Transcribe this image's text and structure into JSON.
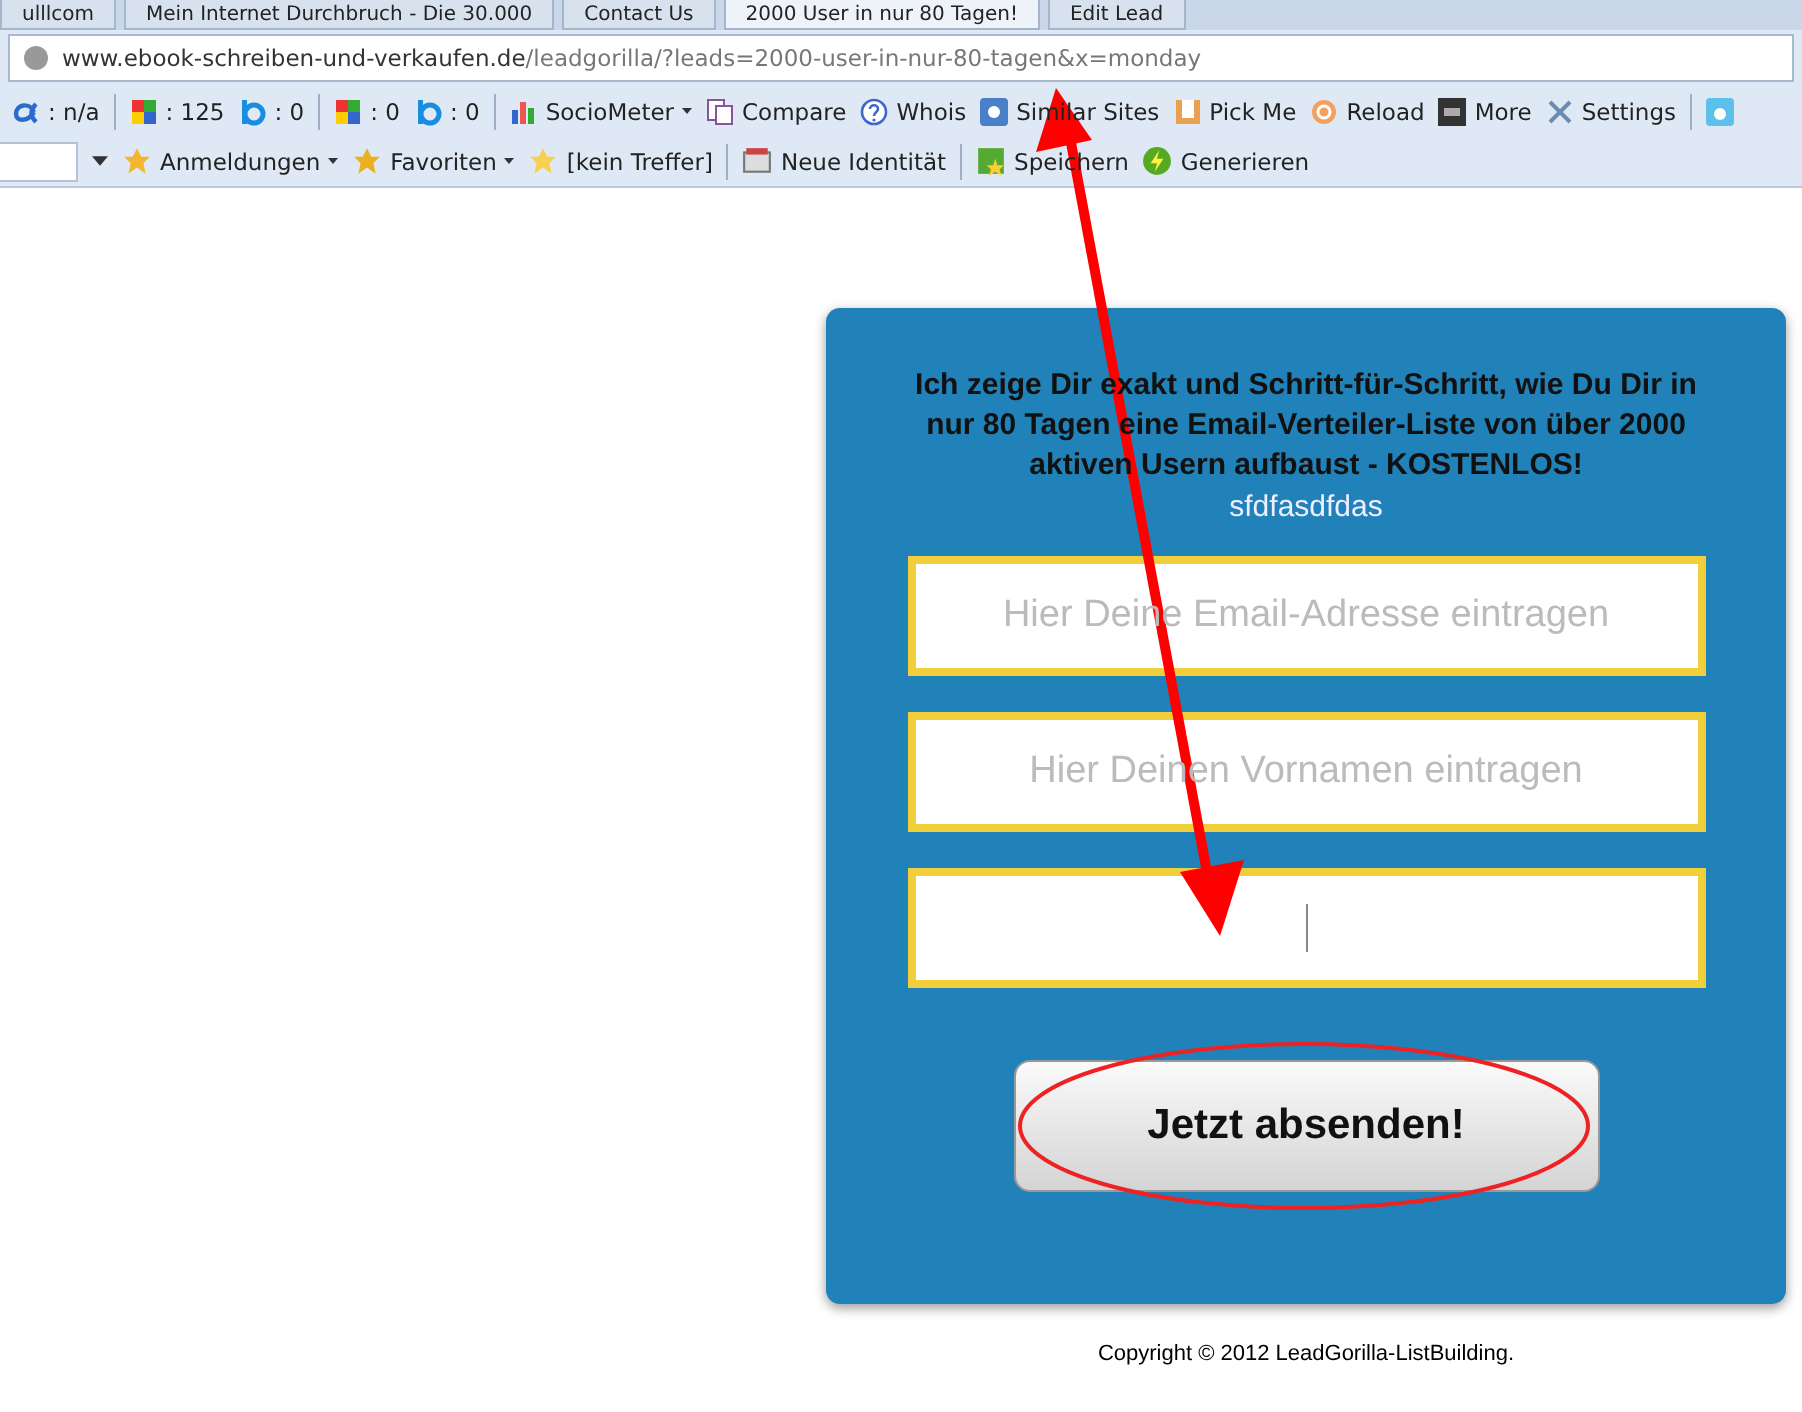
{
  "tabs": [
    {
      "title": "ulllcom",
      "selected": false
    },
    {
      "title": "Mein Internet Durchbruch - Die 30.000",
      "selected": false
    },
    {
      "title": "Contact Us",
      "selected": false
    },
    {
      "title": "2000 User in nur 80 Tagen!",
      "selected": true
    },
    {
      "title": "Edit Lead",
      "selected": false
    }
  ],
  "address_bar": {
    "domain": "www.ebook-schreiben-und-verkaufen.de",
    "path": "/leadgorilla/?leads=2000-user-in-nur-80-tagen&x=monday"
  },
  "toolbar_1": [
    {
      "kind": "stat",
      "label": ": n/a"
    },
    {
      "kind": "sep"
    },
    {
      "kind": "stat",
      "label": ": 125"
    },
    {
      "kind": "stat",
      "label": ": 0"
    },
    {
      "kind": "sep"
    },
    {
      "kind": "stat",
      "label": ": 0"
    },
    {
      "kind": "stat",
      "label": ": 0"
    },
    {
      "kind": "sep"
    },
    {
      "kind": "menu",
      "label": "SocioMeter"
    },
    {
      "kind": "button",
      "label": "Compare"
    },
    {
      "kind": "button",
      "label": "Whois"
    },
    {
      "kind": "button",
      "label": "Similar Sites"
    },
    {
      "kind": "button",
      "label": "Pick Me"
    },
    {
      "kind": "button",
      "label": "Reload"
    },
    {
      "kind": "button",
      "label": "More"
    },
    {
      "kind": "button",
      "label": "Settings"
    },
    {
      "kind": "sep"
    },
    {
      "kind": "icon"
    }
  ],
  "toolbar_2": [
    {
      "kind": "combo"
    },
    {
      "kind": "menu",
      "label": "Anmeldungen"
    },
    {
      "kind": "menu",
      "label": "Favoriten"
    },
    {
      "kind": "button",
      "label": "[kein Treffer]"
    },
    {
      "kind": "sep"
    },
    {
      "kind": "button",
      "label": "Neue Identität"
    },
    {
      "kind": "sep"
    },
    {
      "kind": "button",
      "label": "Speichern"
    },
    {
      "kind": "button",
      "label": "Generieren"
    }
  ],
  "signup_card": {
    "headline": "Ich zeige Dir exakt und Schritt-für-Schritt, wie Du Dir in nur 80 Tagen eine Email-Verteiler-Liste von über 2000 aktiven Usern aufbaust - KOSTENLOS!",
    "subline": "sfdfasdfdas",
    "fields": [
      {
        "placeholder": "Hier Deine Email-Adresse eintragen",
        "focused": false
      },
      {
        "placeholder": "Hier Deinen Vornamen eintragen",
        "focused": false
      },
      {
        "focused": true
      }
    ],
    "submit": "Jetzt absenden!"
  },
  "footer": "Copyright © 2012 LeadGorilla-ListBuilding."
}
